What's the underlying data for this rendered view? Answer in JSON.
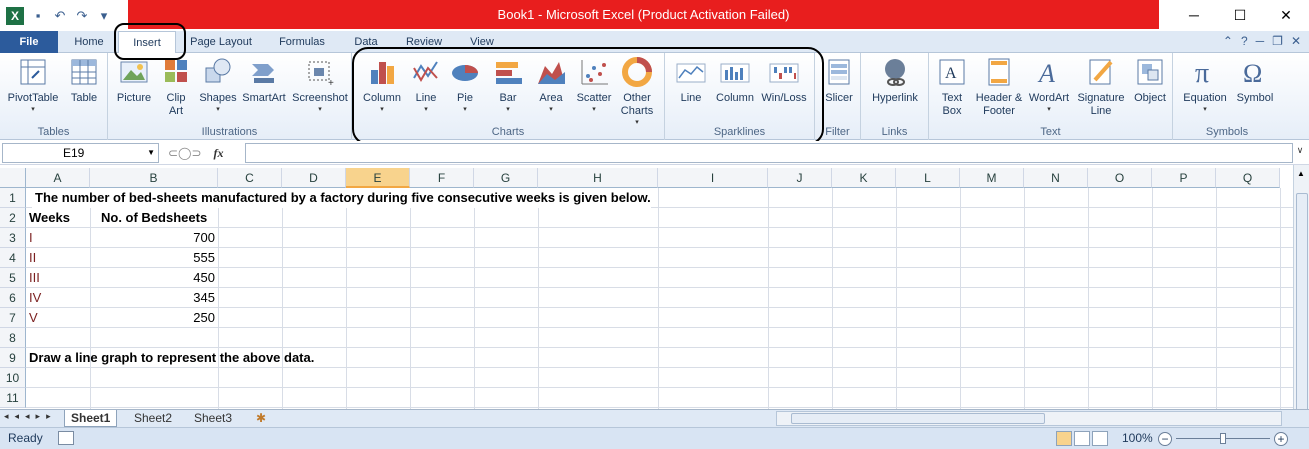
{
  "window": {
    "title": "Book1  -  Microsoft Excel (Product Activation Failed)",
    "title_bar_color": "#e81e1e",
    "controls": [
      "minimize-icon",
      "maximize-icon",
      "close-icon"
    ]
  },
  "ribbon_tabs": [
    "File",
    "Home",
    "Insert",
    "Page Layout",
    "Formulas",
    "Data",
    "Review",
    "View"
  ],
  "active_tab": "Insert",
  "ribbon": {
    "tables": {
      "label": "Tables",
      "items": [
        "PivotTable",
        "Table"
      ]
    },
    "illustrations": {
      "label": "Illustrations",
      "items": [
        "Picture",
        "Clip Art",
        "Shapes",
        "SmartArt",
        "Screenshot"
      ]
    },
    "charts": {
      "label": "Charts",
      "items": [
        "Column",
        "Line",
        "Pie",
        "Bar",
        "Area",
        "Scatter",
        "Other Charts"
      ]
    },
    "sparklines": {
      "label": "Sparklines",
      "items": [
        "Line",
        "Column",
        "Win/Loss"
      ]
    },
    "filter": {
      "label": "Filter",
      "items": [
        "Slicer"
      ]
    },
    "links": {
      "label": "Links",
      "items": [
        "Hyperlink"
      ]
    },
    "text": {
      "label": "Text",
      "items": [
        "Text Box",
        "Header & Footer",
        "WordArt",
        "Signature Line",
        "Object"
      ]
    },
    "symbols": {
      "label": "Symbols",
      "items": [
        "Equation",
        "Symbol"
      ]
    }
  },
  "formula_bar": {
    "name_box": "E19",
    "fx": "fx",
    "formula": ""
  },
  "columns": [
    "A",
    "B",
    "C",
    "D",
    "E",
    "F",
    "G",
    "H",
    "I",
    "J",
    "K",
    "L",
    "M",
    "N",
    "O",
    "P",
    "Q"
  ],
  "selected_column": "E",
  "rows": [
    "1",
    "2",
    "3",
    "4",
    "5",
    "6",
    "7",
    "8",
    "9",
    "10",
    "11"
  ],
  "sheet": {
    "A1": "The number of bed-sheets manufactured by a factory during five consecutive weeks is given below.",
    "A2": "Weeks",
    "B2": "No. of Bedsheets",
    "data": [
      {
        "week": "I",
        "value": "700"
      },
      {
        "week": "II",
        "value": "555"
      },
      {
        "week": "III",
        "value": "450"
      },
      {
        "week": "IV",
        "value": "345"
      },
      {
        "week": "V",
        "value": "250"
      }
    ],
    "A9": "Draw a line graph to represent the above data."
  },
  "sheet_tabs": [
    "Sheet1",
    "Sheet2",
    "Sheet3"
  ],
  "active_sheet": "Sheet1",
  "status": {
    "ready": "Ready",
    "zoom": "100%"
  }
}
